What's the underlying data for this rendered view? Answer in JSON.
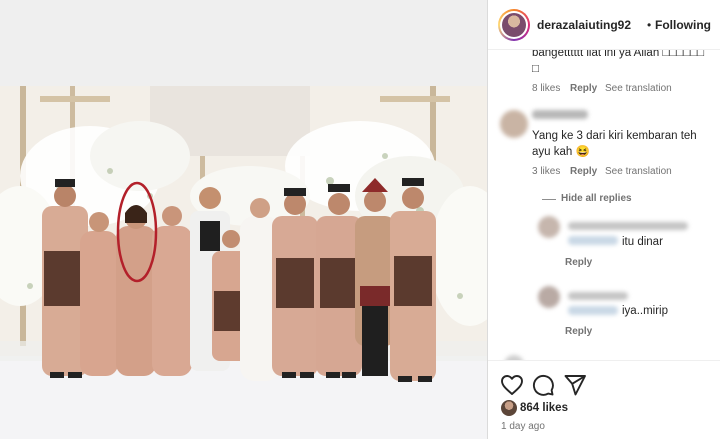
{
  "post": {
    "username": "derazalaiuting92",
    "separator": "•",
    "follow_label": "Following"
  },
  "comments": [
    {
      "text_line1": "bangetttttt liat ini ya Allah □□□□□□",
      "text_line2": "□",
      "likes": "8 likes",
      "reply": "Reply",
      "translate": "See translation"
    },
    {
      "text_line1": "Yang ke 3 dari kiri kembaran teh",
      "text_line2": "ayu kah 😆",
      "likes": "3 likes",
      "reply": "Reply",
      "translate": "See translation"
    }
  ],
  "replies_toggle": "Hide all replies",
  "replies": [
    {
      "text": "itu dinar",
      "reply": "Reply"
    },
    {
      "text": "iya..mirip",
      "reply": "Reply"
    }
  ],
  "footer": {
    "likes": "864 likes",
    "time": "1 day ago"
  },
  "icons": {
    "like": "heart-icon",
    "comment": "comment-icon",
    "share": "send-icon"
  },
  "colors": {
    "text": "#262626",
    "muted": "#737373",
    "border": "#dbdbdb",
    "highlight_circle": "#b3202a"
  }
}
